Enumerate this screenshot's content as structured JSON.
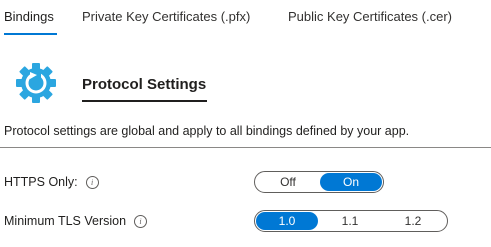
{
  "tabs": [
    {
      "label": "Bindings",
      "active": true
    },
    {
      "label": "Private Key Certificates (.pfx)",
      "active": false
    },
    {
      "label": "Public Key Certificates (.cer)",
      "active": false
    }
  ],
  "section": {
    "icon": "gear-icon",
    "title": "Protocol Settings",
    "description": "Protocol settings are global and apply to all bindings defined by your app."
  },
  "settings": {
    "https_only": {
      "label": "HTTPS Only:",
      "options": [
        "Off",
        "On"
      ],
      "selected": "On"
    },
    "min_tls": {
      "label": "Minimum TLS Version",
      "options": [
        "1.0",
        "1.1",
        "1.2"
      ],
      "selected": "1.0"
    }
  },
  "colors": {
    "accent": "#0078d4",
    "icon": "#2ba6e0",
    "text": "#201f1e"
  }
}
